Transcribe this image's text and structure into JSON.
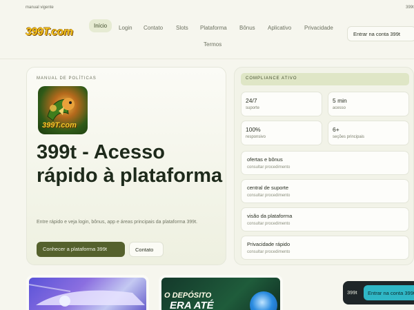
{
  "topbar": {
    "left": "manual vigente",
    "right": "399t"
  },
  "brand": {
    "logo": "399T.com"
  },
  "nav": {
    "items": [
      "Início",
      "Login",
      "Contato",
      "Slots",
      "Plataforma",
      "Bônus",
      "Aplicativo",
      "Privacidade",
      "Termos"
    ],
    "active": "Início"
  },
  "header": {
    "login_label": "Entrar na conta 399t"
  },
  "hero": {
    "kicker": "MANUAL DE POLÍTICAS",
    "icon_label": "399T.com",
    "title": "399t - Acesso rápido à plataforma",
    "description": "Entre rápido e veja login, bônus, app e áreas principais da plataforma 399t.",
    "primary_label": "Conhecer a plataforma 399t",
    "secondary_label": "Contato"
  },
  "panel": {
    "badge": "COMPLIANCE ATIVO",
    "stats": [
      {
        "value": "24/7",
        "label": "suporte"
      },
      {
        "value": "5 min",
        "label": "acesso"
      },
      {
        "value": "100%",
        "label": "responsivo"
      },
      {
        "value": "6+",
        "label": "seções principais"
      }
    ],
    "rows": [
      {
        "title": "ofertas e bônus",
        "sub": "consultar procedimento"
      },
      {
        "title": "central de suporte",
        "sub": "consultar procedimento"
      },
      {
        "title": "visão da plataforma",
        "sub": "consultar procedimento"
      },
      {
        "title": "Privacidade rápido",
        "sub": "consultar procedimento"
      }
    ]
  },
  "cards": {
    "promo_line1": "O DEPÓSITO",
    "promo_line2": "ERA ATÉ"
  },
  "sticky": {
    "brand": "399t",
    "cta": "Entrar na conta 399t"
  },
  "colors": {
    "accent": "#55612d",
    "background": "#f6f6ee",
    "cta": "#2fb7c6"
  }
}
